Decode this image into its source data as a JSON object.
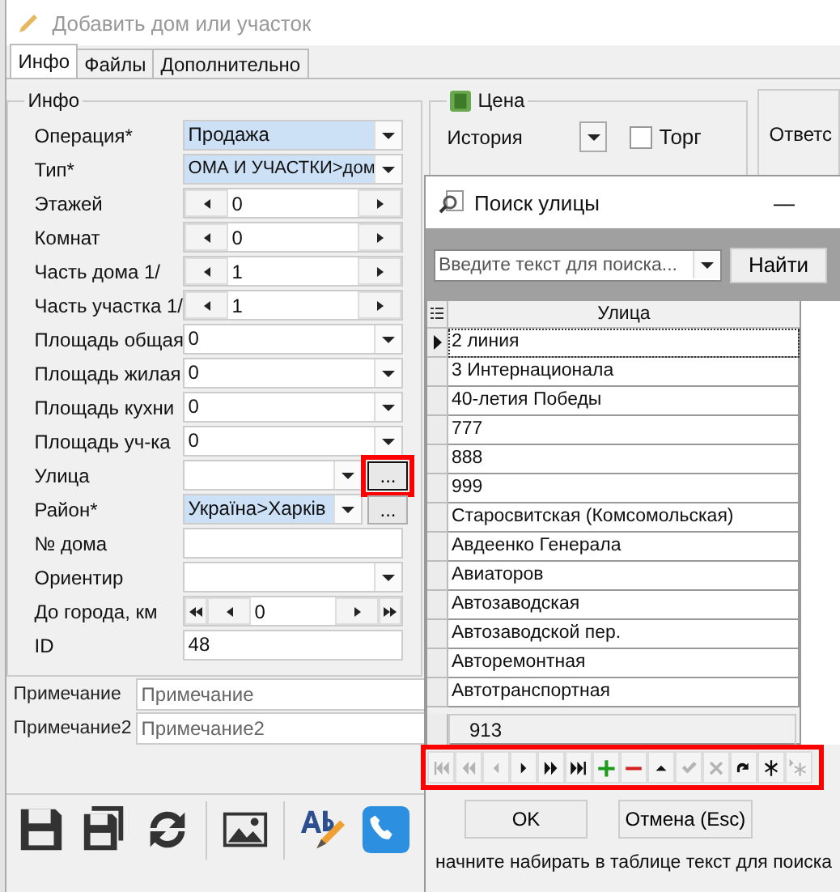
{
  "window": {
    "title": "Добавить дом или участок"
  },
  "tabs": [
    {
      "label": "Инфо",
      "selected": true
    },
    {
      "label": "Файлы",
      "selected": false
    },
    {
      "label": "Дополнительно",
      "selected": false
    }
  ],
  "info_group": {
    "title": "Инфо",
    "fields": [
      {
        "label": "Операция*",
        "kind": "combo",
        "value": "Продажа",
        "highlighted": true
      },
      {
        "label": "Тип*",
        "kind": "combo",
        "value": "ОМА И УЧАСТКИ>дом",
        "highlighted": true
      },
      {
        "label": "Этажей",
        "kind": "spin",
        "value": "0"
      },
      {
        "label": "Комнат",
        "kind": "spin",
        "value": "0"
      },
      {
        "label": "Часть дома 1/",
        "kind": "spin",
        "value": "1"
      },
      {
        "label": "Часть участка 1/",
        "kind": "spin",
        "value": "1"
      },
      {
        "label": "Площадь общая",
        "kind": "combo",
        "value": "0",
        "highlighted": false
      },
      {
        "label": "Площадь жилая",
        "kind": "combo",
        "value": "0",
        "highlighted": false
      },
      {
        "label": "Площадь кухни",
        "kind": "combo",
        "value": "0",
        "highlighted": false
      },
      {
        "label": "Площадь уч-ка",
        "kind": "combo",
        "value": "0",
        "highlighted": false
      },
      {
        "label": "Улица",
        "kind": "lookup",
        "button": "...",
        "highlighted": false,
        "annotated": true
      },
      {
        "label": "Район*",
        "kind": "lookup",
        "value": "Україна>Харків",
        "button": "...",
        "highlighted": true,
        "annotated": false
      },
      {
        "label": "№ дома",
        "kind": "text"
      },
      {
        "label": "Ориентир",
        "kind": "combo",
        "highlighted": false
      },
      {
        "label": "До города, км",
        "kind": "spin4",
        "value": "0"
      },
      {
        "label": "ID",
        "kind": "text",
        "value": "48"
      }
    ]
  },
  "price_group": {
    "title": "Цена",
    "history_label": "История",
    "bargain": {
      "label": "Торг",
      "checked": false
    }
  },
  "side_group": {
    "label": "Ответс"
  },
  "notes": [
    {
      "label": "Примечание",
      "placeholder": "Примечание"
    },
    {
      "label": "Примечание2",
      "placeholder": "Примечание2"
    }
  ],
  "toolbar": [
    {
      "kind": "save"
    },
    {
      "kind": "save-as"
    },
    {
      "kind": "refresh"
    },
    {
      "kind": "image"
    },
    {
      "kind": "spell"
    },
    {
      "kind": "phone"
    }
  ],
  "dialog": {
    "title": "Поиск улицы",
    "minimize": "—",
    "search": {
      "placeholder": "Введите текст для поиска..."
    },
    "find_button": "Найти",
    "grid": {
      "column": "Улица",
      "rows": [
        {
          "name": "2 линия",
          "selected": true
        },
        {
          "name": "3 Интернационала",
          "selected": false
        },
        {
          "name": "40-летия Победы",
          "selected": false
        },
        {
          "name": "777",
          "selected": false
        },
        {
          "name": "888",
          "selected": false
        },
        {
          "name": "999",
          "selected": false
        },
        {
          "name": "Старосвитская (Комсомольская)",
          "selected": false
        },
        {
          "name": "Авдеенко Генерала",
          "selected": false
        },
        {
          "name": "Авиаторов",
          "selected": false
        },
        {
          "name": "Автозаводская",
          "selected": false
        },
        {
          "name": "Автозаводской пер.",
          "selected": false
        },
        {
          "name": "Авторемонтная",
          "selected": false
        },
        {
          "name": "Автотранспортная",
          "selected": false
        }
      ],
      "footer": "913"
    },
    "navigator": {
      "annotated": true,
      "buttons": [
        {
          "kind": "first",
          "disabled": true
        },
        {
          "kind": "prior-page",
          "disabled": true
        },
        {
          "kind": "prior",
          "disabled": true
        },
        {
          "kind": "next",
          "disabled": false
        },
        {
          "kind": "next-page",
          "disabled": false
        },
        {
          "kind": "last",
          "disabled": false
        },
        {
          "kind": "insert",
          "disabled": false
        },
        {
          "kind": "delete",
          "disabled": false
        },
        {
          "kind": "edit",
          "disabled": false
        },
        {
          "kind": "post",
          "disabled": true
        },
        {
          "kind": "cancel",
          "disabled": true
        },
        {
          "kind": "refresh",
          "disabled": false
        },
        {
          "kind": "bookmark",
          "disabled": false
        },
        {
          "kind": "goto-bookmark",
          "disabled": true
        }
      ]
    },
    "ok_button": "OK",
    "cancel_button": "Отмена (Esc)",
    "hint": "начните набирать в таблице текст для поиска"
  }
}
